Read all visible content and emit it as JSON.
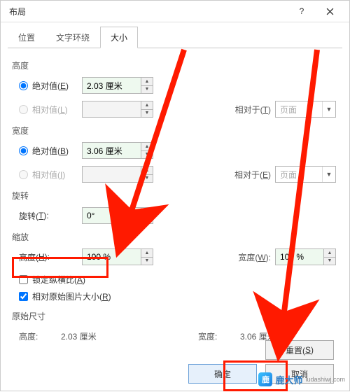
{
  "window": {
    "title": "布局"
  },
  "tabs": {
    "pos": "位置",
    "wrap": "文字环绕",
    "size": "大小"
  },
  "groups": {
    "height": "高度",
    "width": "宽度",
    "rotation": "旋转",
    "scale": "缩放",
    "original": "原始尺寸"
  },
  "height": {
    "absolute_label": "绝对值(E)",
    "absolute_value": "2.03 厘米",
    "relative_label": "相对值(L)",
    "relative_value": "",
    "relative_to_label": "相对于(T)",
    "relative_to_value": "页面"
  },
  "width": {
    "absolute_label": "绝对值(B)",
    "absolute_value": "3.06 厘米",
    "relative_label": "相对值(I)",
    "relative_value": "",
    "relative_to_label": "相对于(E)",
    "relative_to_value": "页面"
  },
  "rotation": {
    "label": "旋转(T):",
    "value": "0°"
  },
  "scale": {
    "h_label": "高度(H):",
    "h_value": "100 %",
    "w_label": "宽度(W):",
    "w_value": "100 %",
    "lock_label": "锁定纵横比(A)",
    "orig_label": "相对原始图片大小(R)"
  },
  "original": {
    "h_label": "高度:",
    "h_value": "2.03 厘米",
    "w_label": "宽度:",
    "w_value": "3.06 厘米"
  },
  "buttons": {
    "reset": "重置(S)",
    "ok": "确定",
    "cancel": "取消"
  },
  "watermark": "鹿大师"
}
